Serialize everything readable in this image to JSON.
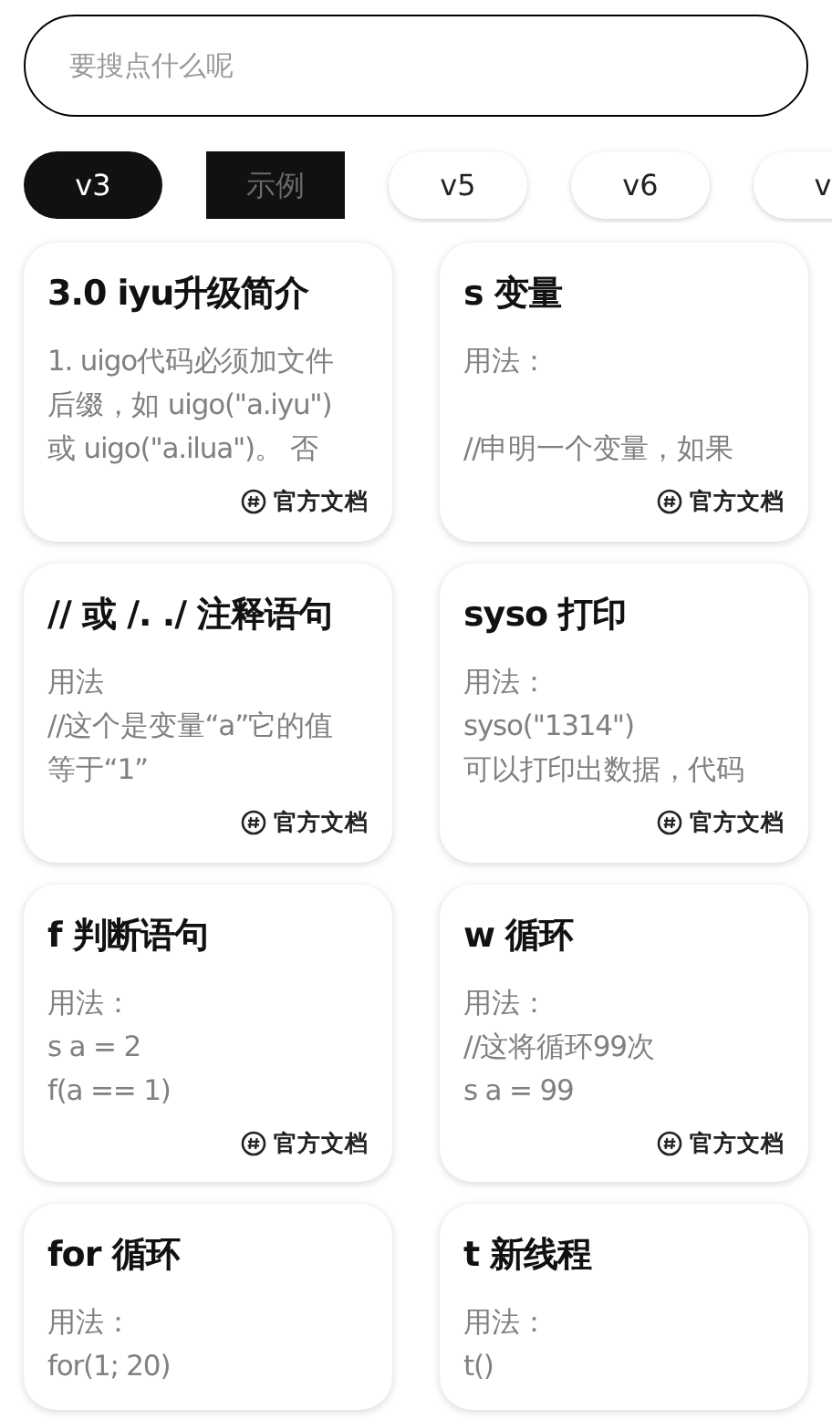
{
  "search": {
    "placeholder": "要搜点什么呢"
  },
  "tabs": [
    {
      "label": "v3",
      "selected": true,
      "pressed": false
    },
    {
      "label": "示例",
      "selected": false,
      "pressed": true
    },
    {
      "label": "v5",
      "selected": false,
      "pressed": false
    },
    {
      "label": "v6",
      "selected": false,
      "pressed": false
    },
    {
      "label": "v",
      "selected": false,
      "pressed": false
    }
  ],
  "columns": [
    {
      "cards": [
        {
          "title": "3.0 iyu升级简介",
          "paragraphs": [
            [
              "1. uigo代码必须加文件",
              "后缀，如 uigo(\"a.iyu\")",
              "或 uigo(\"a.ilua\")。 否"
            ]
          ],
          "link": "官方文档"
        },
        {
          "title": "// 或 /. ./ 注释语句",
          "paragraphs": [
            [
              "用法",
              "//这个是变量“a”它的值",
              "等于“1”"
            ]
          ],
          "link": "官方文档"
        },
        {
          "title": "f 判断语句",
          "paragraphs": [
            [
              "用法：",
              "s a = 2",
              "f(a == 1)"
            ]
          ],
          "link": "官方文档"
        },
        {
          "title": "for 循环",
          "paragraphs": [
            [
              "用法：",
              "for(1; 20)"
            ]
          ]
        }
      ]
    },
    {
      "cards": [
        {
          "title": "s 变量",
          "paragraphs": [
            [
              "用法："
            ],
            [
              "//申明一个变量，如果"
            ]
          ],
          "link": "官方文档"
        },
        {
          "title": "syso 打印",
          "paragraphs": [
            [
              "用法：",
              "syso(\"1314\")",
              "可以打印出数据，代码"
            ]
          ],
          "link": "官方文档"
        },
        {
          "title": "w 循环",
          "paragraphs": [
            [
              "用法：",
              "//这将循环99次",
              "s a = 99"
            ]
          ],
          "link": "官方文档"
        },
        {
          "title": "t 新线程",
          "paragraphs": [
            [
              "用法：",
              "t()"
            ]
          ]
        }
      ]
    }
  ]
}
